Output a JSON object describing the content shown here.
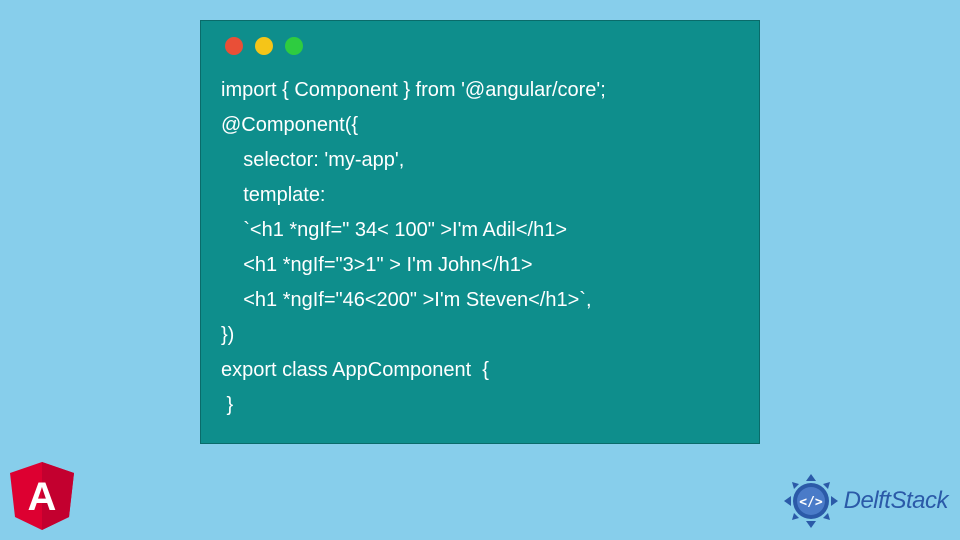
{
  "code": {
    "lines": [
      "import { Component } from '@angular/core';",
      "@Component({",
      "    selector: 'my-app',",
      "    template:",
      "    `<h1 *ngIf=\" 34< 100\" >I'm Adil</h1>",
      "    <h1 *ngIf=\"3>1\" > I'm John</h1>",
      "    <h1 *ngIf=\"46<200\" >I'm Steven</h1>`,",
      "})",
      "export class AppComponent  {",
      " }"
    ]
  },
  "logos": {
    "angular_letter": "A",
    "delft_text": "DelftStack"
  },
  "colors": {
    "background": "#87CEEB",
    "code_bg": "#0E8E8C",
    "angular_red": "#DD0031",
    "delft_blue": "#2B5AA8"
  }
}
